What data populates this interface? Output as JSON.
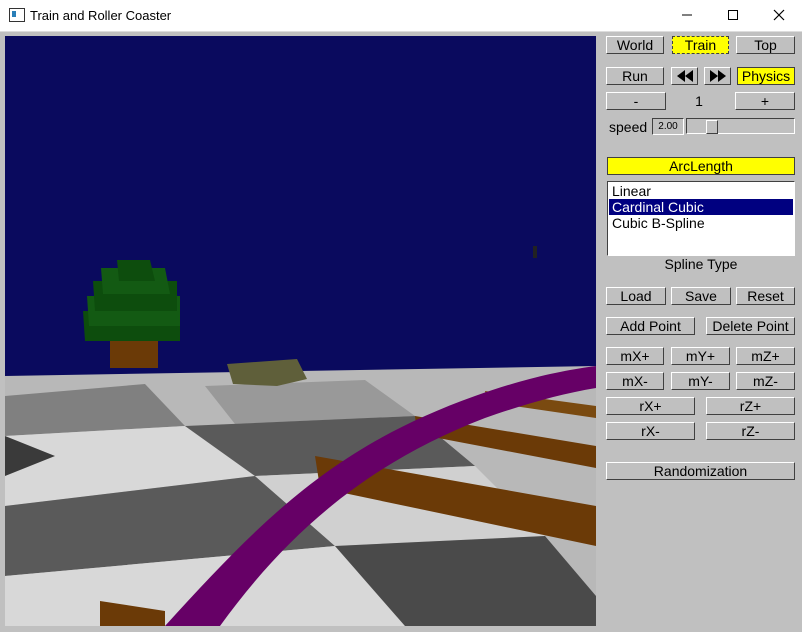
{
  "window": {
    "title": "Train and Roller Coaster",
    "minimize_icon": "minimize-icon",
    "maximize_icon": "maximize-icon",
    "close_icon": "close-icon"
  },
  "colors": {
    "sky": "#0a0a5e",
    "active_button": "#ffff00",
    "track": "#660066",
    "ties": "#6b3a07",
    "tree": "#0d4d0d",
    "panel": "#c0c0c0"
  },
  "camera": {
    "world": "World",
    "train": "Train",
    "top": "Top",
    "selected": "Train"
  },
  "playback": {
    "run": "Run",
    "rewind_icon": "rewind-icon",
    "fast_forward_icon": "fast-forward-icon",
    "physics": "Physics",
    "minus": "-",
    "plus": "+",
    "car_count": "1"
  },
  "speed": {
    "label": "speed",
    "value": "2.00",
    "slider_fraction": 0.2
  },
  "arc_length": "ArcLength",
  "spline": {
    "options": [
      "Linear",
      "Cardinal Cubic",
      "Cubic B-Spline"
    ],
    "selected_index": 1,
    "label": "Spline Type"
  },
  "file": {
    "load": "Load",
    "save": "Save",
    "reset": "Reset"
  },
  "points": {
    "add": "Add Point",
    "delete": "Delete Point"
  },
  "move": {
    "mx_plus": "mX+",
    "my_plus": "mY+",
    "mz_plus": "mZ+",
    "mx_minus": "mX-",
    "my_minus": "mY-",
    "mz_minus": "mZ-"
  },
  "rotate": {
    "rx_plus": "rX+",
    "rz_plus": "rZ+",
    "rx_minus": "rX-",
    "rz_minus": "rZ-"
  },
  "randomization": "Randomization"
}
